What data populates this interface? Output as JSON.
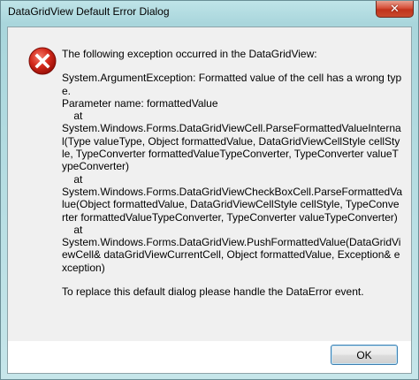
{
  "window": {
    "title": "DataGridView Default Error Dialog",
    "close_glyph": "✕"
  },
  "dialog": {
    "icon": "error-icon",
    "intro": "The following exception occurred in the DataGridView:",
    "exception_text": "System.ArgumentException: Formatted value of the cell has a wrong type.\nParameter name: formattedValue\n    at\nSystem.Windows.Forms.DataGridViewCell.ParseFormattedValueInternal(Type valueType, Object formattedValue, DataGridViewCellStyle cellStyle, TypeConverter formattedValueTypeConverter, TypeConverter valueTypeConverter)\n    at\nSystem.Windows.Forms.DataGridViewCheckBoxCell.ParseFormattedValue(Object formattedValue, DataGridViewCellStyle cellStyle, TypeConverter formattedValueTypeConverter, TypeConverter valueTypeConverter)\n    at\nSystem.Windows.Forms.DataGridView.PushFormattedValue(DataGridViewCell& dataGridViewCurrentCell, Object formattedValue, Exception& exception)",
    "footer": "To replace this default dialog please handle the DataError event.",
    "ok_label": "OK"
  },
  "colors": {
    "error_red": "#cc1f1f",
    "close_red": "#c1341c",
    "frame": "#a9d6dc"
  }
}
